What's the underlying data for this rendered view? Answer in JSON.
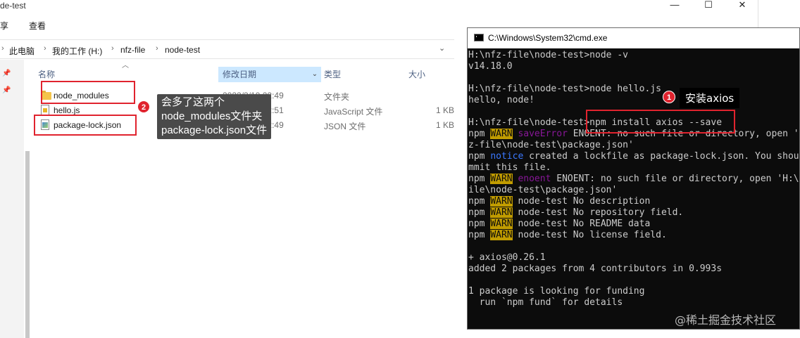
{
  "explorer": {
    "window_title": "de-test",
    "ribbon": {
      "share": "享",
      "view": "查看"
    },
    "breadcrumb": [
      "此电脑",
      "我的工作 (H:)",
      "nfz-file",
      "node-test"
    ],
    "columns": {
      "name": "名称",
      "date": "修改日期",
      "type": "类型",
      "size": "大小"
    },
    "files": [
      {
        "name": "node_modules",
        "date": "2022/3/19 22:49",
        "type": "文件夹",
        "size": ""
      },
      {
        "name": "hello.js",
        "date": "2022/3/19 22:51",
        "type": "JavaScript 文件",
        "size": "1 KB"
      },
      {
        "name": "package-lock.json",
        "date": "2022/3/19 22:49",
        "type": "JSON 文件",
        "size": "1 KB"
      }
    ]
  },
  "annotations": {
    "badge1": "1",
    "label1": "安装axios",
    "badge2": "2",
    "tooltip2": "会多了这两个\nnode_modules文件夹\npackage-lock.json文件"
  },
  "cmd": {
    "title": "C:\\Windows\\System32\\cmd.exe",
    "lines": [
      "H:\\nfz-file\\node-test>node -v",
      "v14.18.0",
      "",
      "H:\\nfz-file\\node-test>node hello.js",
      "hello, node!",
      "",
      "H:\\nfz-file\\node-test>npm install axios --save",
      "npm |WARN| saveError ENOENT: no such file or directory, open 'H:\\nf",
      "z-file\\node-test\\package.json'",
      "npm |notice| created a lockfile as package-lock.json. You should co",
      "mmit this file.",
      "npm |WARN| enoent ENOENT: no such file or directory, open 'H:\\nfz-f",
      "ile\\node-test\\package.json'",
      "npm |WARN| node-test No description",
      "npm |WARN| node-test No repository field.",
      "npm |WARN| node-test No README data",
      "npm |WARN| node-test No license field.",
      "",
      "+ axios@0.26.1",
      "added 2 packages from 4 contributors in 0.993s",
      "",
      "1 package is looking for funding",
      "  run `npm fund` for details"
    ]
  },
  "watermark": "@稀土掘金技术社区"
}
